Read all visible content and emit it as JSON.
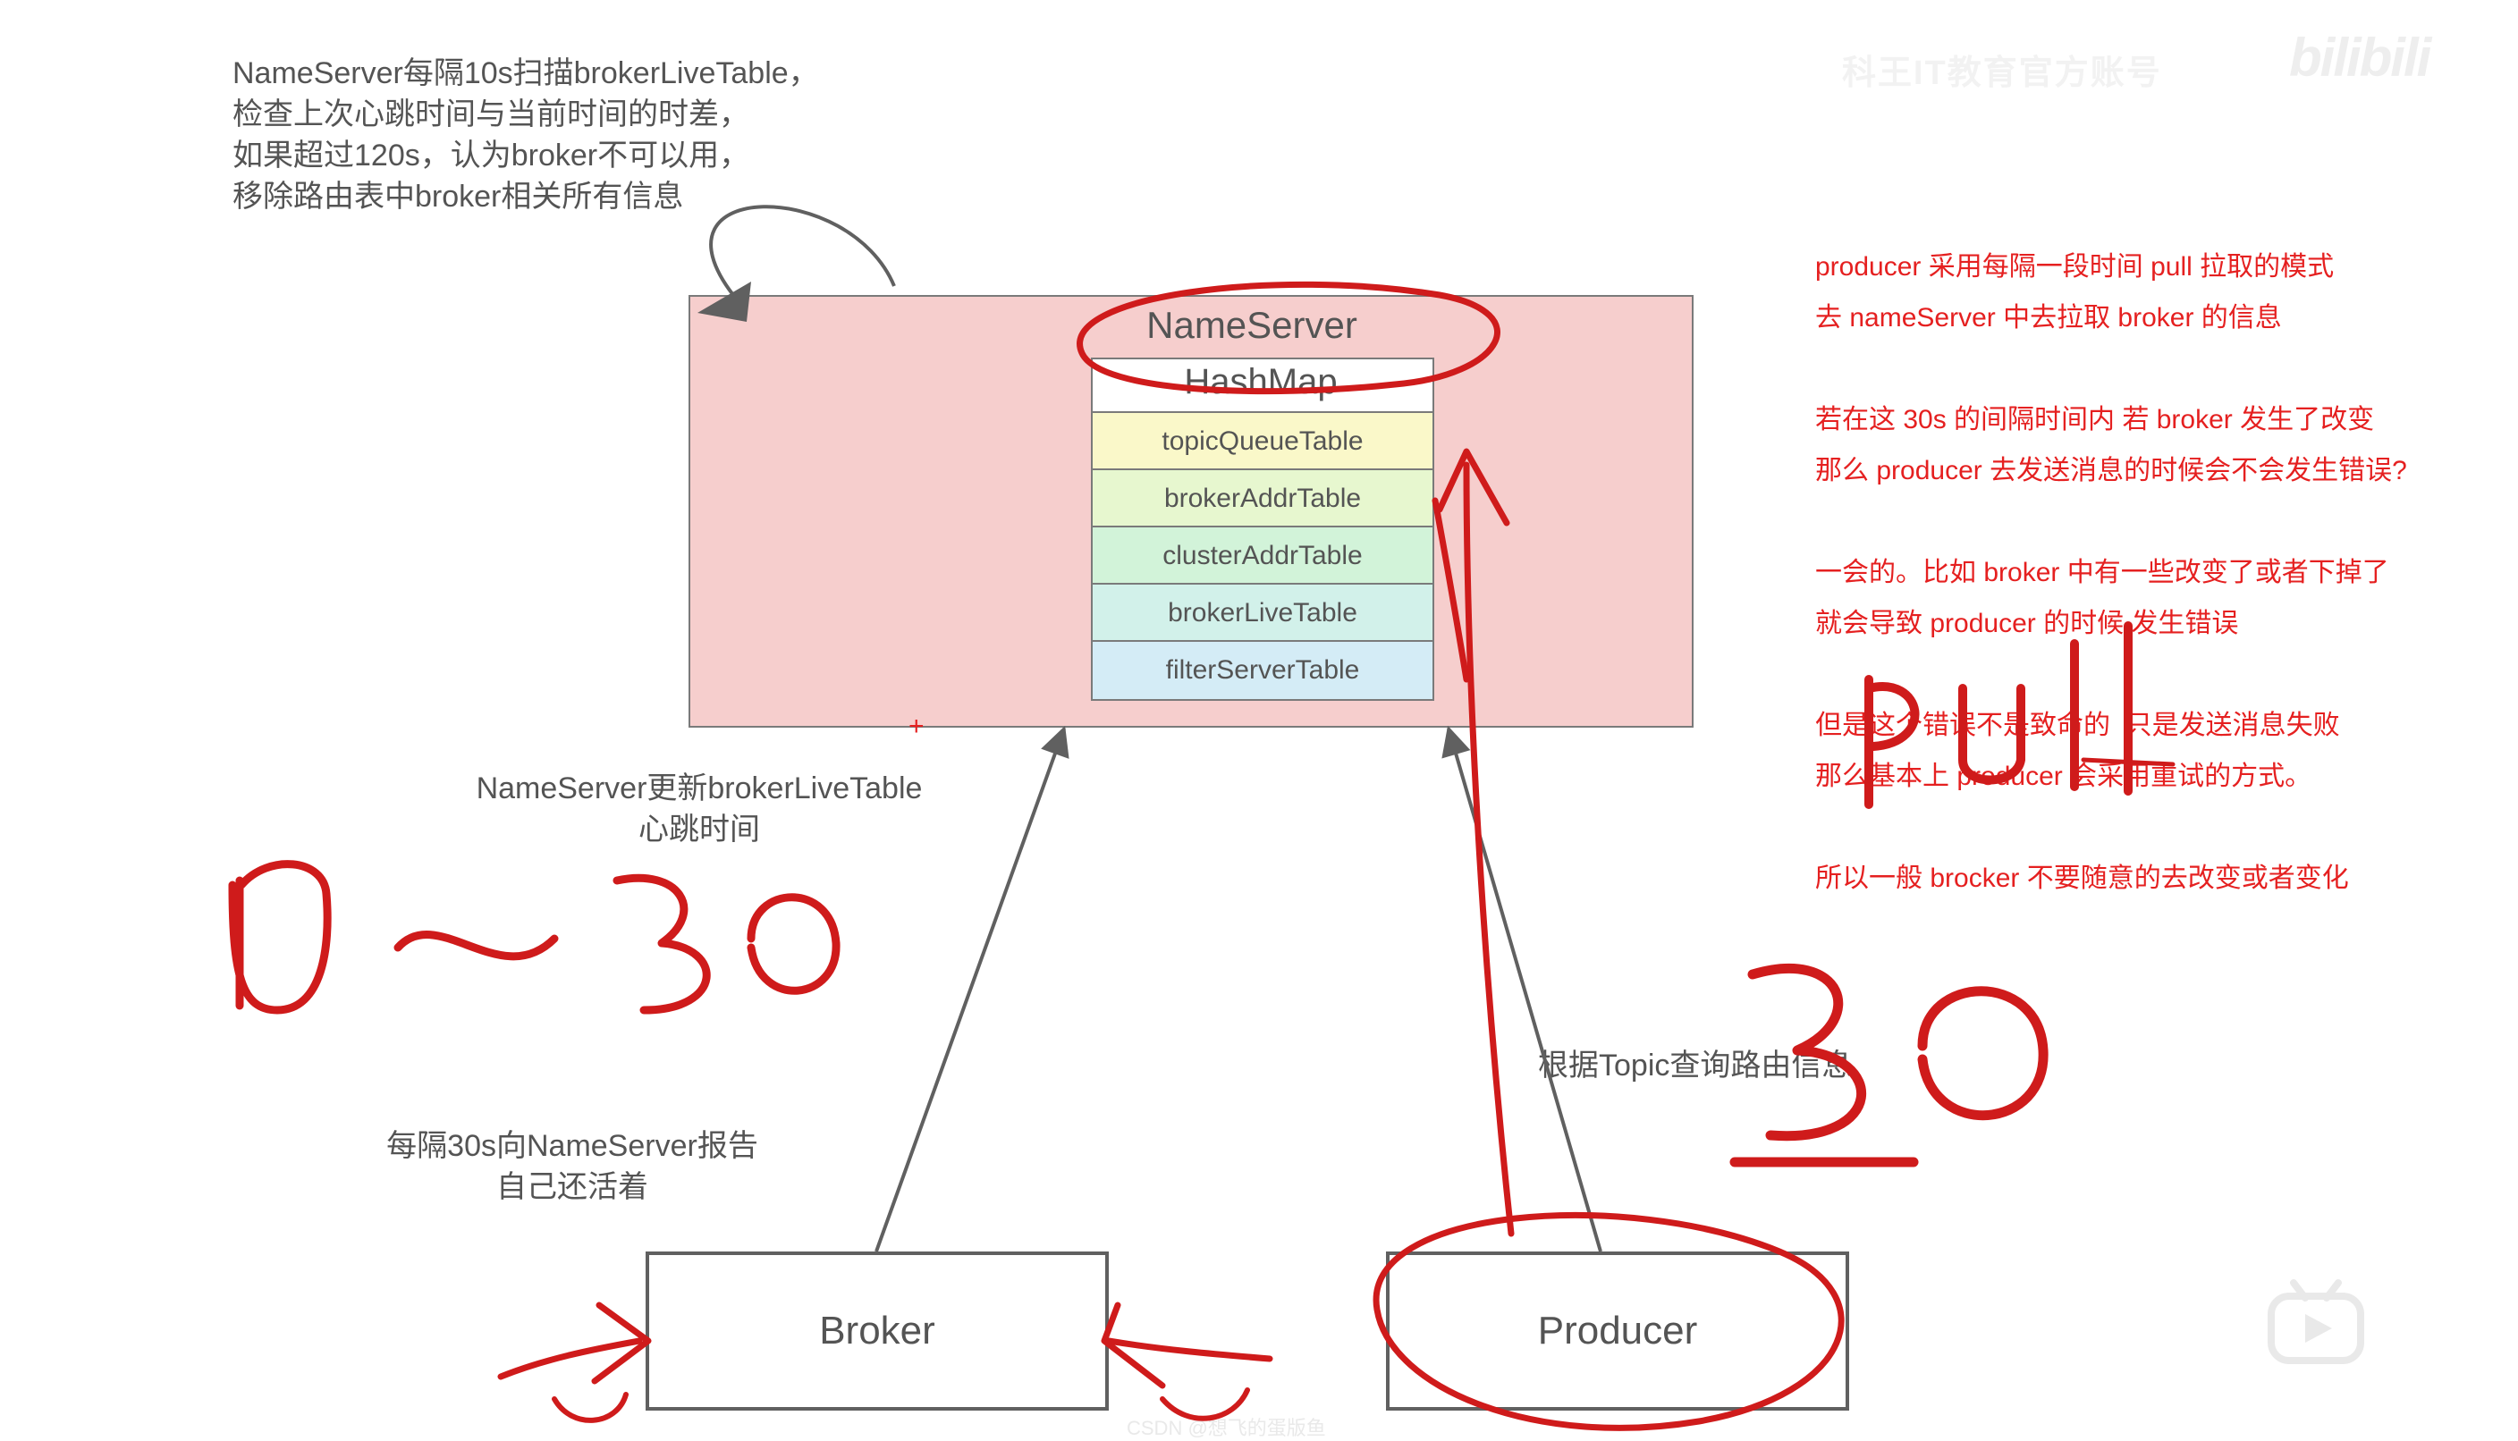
{
  "topLeftNote": "NameServer每隔10s扫描brokerLiveTable，\n检查上次心跳时间与当前时间的时差，\n如果超过120s，认为broker不可以用，\n移除路由表中broker相关所有信息",
  "nameServer": {
    "title": "NameServer",
    "mapTitle": "HashMap",
    "rows": [
      "topicQueueTable",
      "brokerAddrTable",
      "clusterAddrTable",
      "brokerLiveTable",
      "filterServerTable"
    ]
  },
  "midNote": "NameServer更新brokerLiveTable\n心跳时间",
  "brokerNote": "每隔30s向NameServer报告\n自己还活着",
  "topicNote": "根据Topic查询路由信息",
  "brokerLabel": "Broker",
  "producerLabel": "Producer",
  "rightAnnotation": "producer 采用每隔一段时间 pull 拉取的模式\n去 nameServer 中去拉取 broker 的信息\n\n若在这 30s 的间隔时间内 若 broker 发生了改变\n那么 producer 去发送消息的时候会不会发生错误?\n\n一会的。比如 broker 中有一些改变了或者下掉了\n就会导致 producer 的时候 发生错误\n\n但是这个错误不是致命的  只是发送消息失败\n那么基本上 producer 会采用重试的方式。\n\n所以一般 brocker 不要随意的去改变或者变化",
  "plusMark": "+",
  "watermarkTop": "科王IT教育官方账号",
  "bilibili": "bilibili",
  "watermarkBottom": "CSDN @想飞的蛋版鱼",
  "handwriting": {
    "range": "0 ~ 30",
    "pull": "pull",
    "thirty": "30"
  }
}
